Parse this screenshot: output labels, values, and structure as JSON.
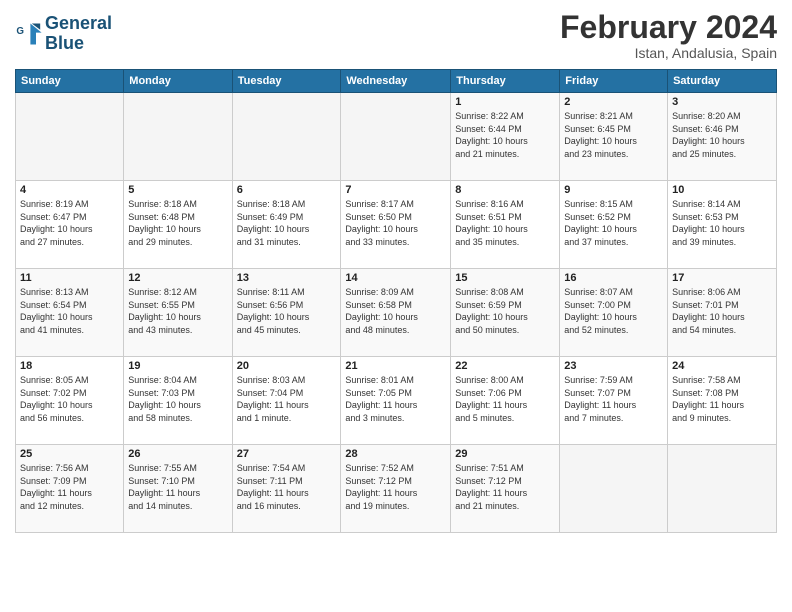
{
  "logo": {
    "line1": "General",
    "line2": "Blue"
  },
  "title": "February 2024",
  "subtitle": "Istan, Andalusia, Spain",
  "days_header": [
    "Sunday",
    "Monday",
    "Tuesday",
    "Wednesday",
    "Thursday",
    "Friday",
    "Saturday"
  ],
  "weeks": [
    [
      {
        "day": "",
        "info": ""
      },
      {
        "day": "",
        "info": ""
      },
      {
        "day": "",
        "info": ""
      },
      {
        "day": "",
        "info": ""
      },
      {
        "day": "1",
        "info": "Sunrise: 8:22 AM\nSunset: 6:44 PM\nDaylight: 10 hours\nand 21 minutes."
      },
      {
        "day": "2",
        "info": "Sunrise: 8:21 AM\nSunset: 6:45 PM\nDaylight: 10 hours\nand 23 minutes."
      },
      {
        "day": "3",
        "info": "Sunrise: 8:20 AM\nSunset: 6:46 PM\nDaylight: 10 hours\nand 25 minutes."
      }
    ],
    [
      {
        "day": "4",
        "info": "Sunrise: 8:19 AM\nSunset: 6:47 PM\nDaylight: 10 hours\nand 27 minutes."
      },
      {
        "day": "5",
        "info": "Sunrise: 8:18 AM\nSunset: 6:48 PM\nDaylight: 10 hours\nand 29 minutes."
      },
      {
        "day": "6",
        "info": "Sunrise: 8:18 AM\nSunset: 6:49 PM\nDaylight: 10 hours\nand 31 minutes."
      },
      {
        "day": "7",
        "info": "Sunrise: 8:17 AM\nSunset: 6:50 PM\nDaylight: 10 hours\nand 33 minutes."
      },
      {
        "day": "8",
        "info": "Sunrise: 8:16 AM\nSunset: 6:51 PM\nDaylight: 10 hours\nand 35 minutes."
      },
      {
        "day": "9",
        "info": "Sunrise: 8:15 AM\nSunset: 6:52 PM\nDaylight: 10 hours\nand 37 minutes."
      },
      {
        "day": "10",
        "info": "Sunrise: 8:14 AM\nSunset: 6:53 PM\nDaylight: 10 hours\nand 39 minutes."
      }
    ],
    [
      {
        "day": "11",
        "info": "Sunrise: 8:13 AM\nSunset: 6:54 PM\nDaylight: 10 hours\nand 41 minutes."
      },
      {
        "day": "12",
        "info": "Sunrise: 8:12 AM\nSunset: 6:55 PM\nDaylight: 10 hours\nand 43 minutes."
      },
      {
        "day": "13",
        "info": "Sunrise: 8:11 AM\nSunset: 6:56 PM\nDaylight: 10 hours\nand 45 minutes."
      },
      {
        "day": "14",
        "info": "Sunrise: 8:09 AM\nSunset: 6:58 PM\nDaylight: 10 hours\nand 48 minutes."
      },
      {
        "day": "15",
        "info": "Sunrise: 8:08 AM\nSunset: 6:59 PM\nDaylight: 10 hours\nand 50 minutes."
      },
      {
        "day": "16",
        "info": "Sunrise: 8:07 AM\nSunset: 7:00 PM\nDaylight: 10 hours\nand 52 minutes."
      },
      {
        "day": "17",
        "info": "Sunrise: 8:06 AM\nSunset: 7:01 PM\nDaylight: 10 hours\nand 54 minutes."
      }
    ],
    [
      {
        "day": "18",
        "info": "Sunrise: 8:05 AM\nSunset: 7:02 PM\nDaylight: 10 hours\nand 56 minutes."
      },
      {
        "day": "19",
        "info": "Sunrise: 8:04 AM\nSunset: 7:03 PM\nDaylight: 10 hours\nand 58 minutes."
      },
      {
        "day": "20",
        "info": "Sunrise: 8:03 AM\nSunset: 7:04 PM\nDaylight: 11 hours\nand 1 minute."
      },
      {
        "day": "21",
        "info": "Sunrise: 8:01 AM\nSunset: 7:05 PM\nDaylight: 11 hours\nand 3 minutes."
      },
      {
        "day": "22",
        "info": "Sunrise: 8:00 AM\nSunset: 7:06 PM\nDaylight: 11 hours\nand 5 minutes."
      },
      {
        "day": "23",
        "info": "Sunrise: 7:59 AM\nSunset: 7:07 PM\nDaylight: 11 hours\nand 7 minutes."
      },
      {
        "day": "24",
        "info": "Sunrise: 7:58 AM\nSunset: 7:08 PM\nDaylight: 11 hours\nand 9 minutes."
      }
    ],
    [
      {
        "day": "25",
        "info": "Sunrise: 7:56 AM\nSunset: 7:09 PM\nDaylight: 11 hours\nand 12 minutes."
      },
      {
        "day": "26",
        "info": "Sunrise: 7:55 AM\nSunset: 7:10 PM\nDaylight: 11 hours\nand 14 minutes."
      },
      {
        "day": "27",
        "info": "Sunrise: 7:54 AM\nSunset: 7:11 PM\nDaylight: 11 hours\nand 16 minutes."
      },
      {
        "day": "28",
        "info": "Sunrise: 7:52 AM\nSunset: 7:12 PM\nDaylight: 11 hours\nand 19 minutes."
      },
      {
        "day": "29",
        "info": "Sunrise: 7:51 AM\nSunset: 7:12 PM\nDaylight: 11 hours\nand 21 minutes."
      },
      {
        "day": "",
        "info": ""
      },
      {
        "day": "",
        "info": ""
      }
    ]
  ]
}
